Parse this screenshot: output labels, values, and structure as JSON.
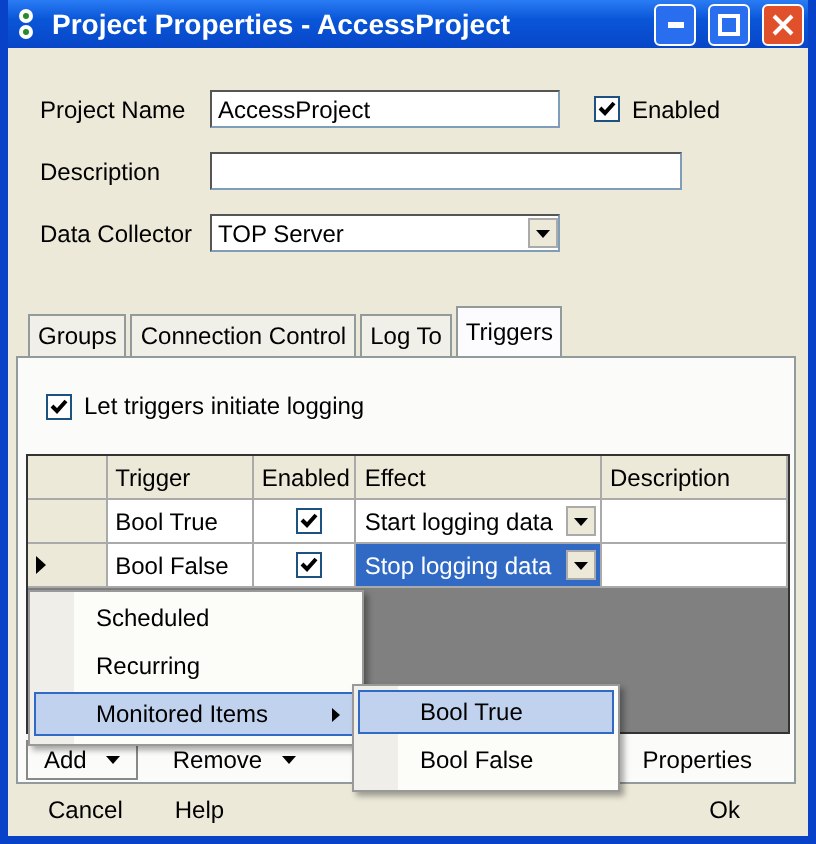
{
  "window": {
    "title": "Project Properties - AccessProject"
  },
  "fields": [
    {
      "label": "Project Name",
      "kind": "text",
      "value": "AccessProject"
    },
    {
      "label": "Description",
      "kind": "text"
    },
    {
      "label": "Data Collector",
      "kind": "select",
      "value": "TOP Server"
    }
  ],
  "enabled": {
    "label": "Enabled",
    "checked": true
  },
  "tabs": [
    {
      "label": "Groups",
      "selected": false
    },
    {
      "label": "Connection Control",
      "selected": false
    },
    {
      "label": "Log To",
      "selected": false
    },
    {
      "label": "Triggers",
      "selected": true
    }
  ],
  "triggers_checkbox": {
    "label": "Let triggers initiate logging",
    "checked": true
  },
  "grid": {
    "columns": [
      "Trigger",
      "Enabled",
      "Effect",
      "Description"
    ],
    "rows": [
      {
        "trigger": "Bool True",
        "enabled": true,
        "effect": "Start logging data",
        "current": false,
        "selected": false
      },
      {
        "trigger": "Bool False",
        "enabled": true,
        "effect": "Stop logging data",
        "current": true,
        "selected": true
      }
    ]
  },
  "toolbar": [
    {
      "label": "Add",
      "dropdown": true,
      "open": true
    },
    {
      "label": "Remove",
      "dropdown": true,
      "open": false
    },
    {
      "label": "Properties",
      "dropdown": false,
      "open": false
    }
  ],
  "menu": [
    {
      "label": "Scheduled",
      "selected": false,
      "submenu": false
    },
    {
      "label": "Recurring",
      "selected": false,
      "submenu": false
    },
    {
      "label": "Monitored Items",
      "selected": true,
      "submenu": true
    }
  ],
  "submenu": [
    {
      "label": "Bool True",
      "selected": true
    },
    {
      "label": "Bool False",
      "selected": false
    }
  ],
  "buttons": [
    "Cancel",
    "Help",
    "Ok"
  ]
}
